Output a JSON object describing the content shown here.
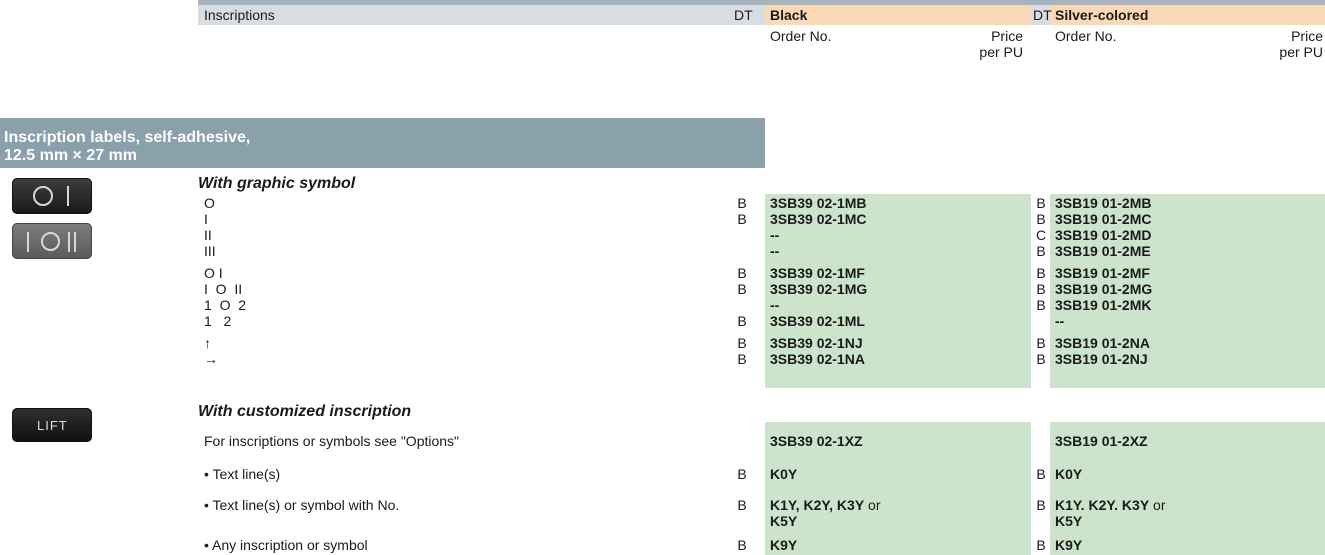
{
  "header": {
    "inscriptions_label": "Inscriptions",
    "dt_label": "DT",
    "black_label": "Black",
    "silver_label": "Silver-colored",
    "order_no_label": "Order No.",
    "price_label_1": "Price",
    "price_label_2": "per PU"
  },
  "section": {
    "title_line1": "Inscription labels, self-adhesive,",
    "title_line2": "12.5 mm × 27 mm"
  },
  "subheads": {
    "graphic": "With graphic symbol",
    "custom": "With customized inscription"
  },
  "graphic_rows": [
    {
      "label": "O",
      "dt_black": "B",
      "black": "3SB39 02-1MB",
      "dt_silver": "B",
      "silver": "3SB19 01-2MB"
    },
    {
      "label": "I",
      "dt_black": "B",
      "black": "3SB39 02-1MC",
      "dt_silver": "B",
      "silver": "3SB19 01-2MC"
    },
    {
      "label": "II",
      "dt_black": "",
      "black": "--",
      "dt_silver": "C",
      "silver": "3SB19 01-2MD"
    },
    {
      "label": "III",
      "dt_black": "",
      "black": "--",
      "dt_silver": "B",
      "silver": "3SB19 01-2ME"
    },
    {
      "label": "O I",
      "dt_black": "B",
      "black": "3SB39 02-1MF",
      "dt_silver": "B",
      "silver": "3SB19 01-2MF"
    },
    {
      "label": "I  O  II",
      "dt_black": "B",
      "black": "3SB39 02-1MG",
      "dt_silver": "B",
      "silver": "3SB19 01-2MG"
    },
    {
      "label": "1  O  2",
      "dt_black": "",
      "black": "--",
      "dt_silver": "B",
      "silver": "3SB19 01-2MK"
    },
    {
      "label": "1   2",
      "dt_black": "B",
      "black": "3SB39 02-1ML",
      "dt_silver": "",
      "silver": "--"
    },
    {
      "label": "↑",
      "dt_black": "B",
      "black": "3SB39 02-1NJ",
      "dt_silver": "B",
      "silver": "3SB19 01-2NA"
    },
    {
      "label": "→",
      "dt_black": "B",
      "black": "3SB39 02-1NA",
      "dt_silver": "B",
      "silver": "3SB19 01-2NJ"
    }
  ],
  "custom_rows": [
    {
      "label": "For inscriptions or symbols see \"Options\"",
      "dt_black": "",
      "black": "3SB39 02-1XZ",
      "black_suffix": "",
      "black_line2": "",
      "dt_silver": "",
      "silver": "3SB19 01-2XZ",
      "silver_suffix": "",
      "silver_line2": ""
    },
    {
      "label": "• Text line(s)",
      "dt_black": "B",
      "black": "K0Y",
      "black_suffix": "",
      "black_line2": "",
      "dt_silver": "B",
      "silver": "K0Y",
      "silver_suffix": "",
      "silver_line2": ""
    },
    {
      "label": "• Text line(s) or symbol with No.",
      "dt_black": "B",
      "black": "K1Y, K2Y, K3Y",
      "black_suffix": " or",
      "black_line2": "K5Y",
      "dt_silver": "B",
      "silver": "K1Y. K2Y. K3Y",
      "silver_suffix": " or",
      "silver_line2": "K5Y"
    },
    {
      "label": "• Any inscription or symbol",
      "dt_black": "B",
      "black": "K9Y",
      "black_suffix": "",
      "black_line2": "",
      "dt_silver": "B",
      "silver": "K9Y",
      "silver_suffix": "",
      "silver_line2": ""
    }
  ],
  "images": {
    "thumb1": "O-I-button-icon",
    "thumb2": "I-O-II-button-icon",
    "thumb3": "LIFT-button-icon",
    "lift_text": "LIFT"
  },
  "colors": {
    "header_bg": "#d8dde1",
    "section_bg": "#8aa0ab",
    "black_header": "#fcd9b6",
    "order_green": "#cce3cc"
  }
}
